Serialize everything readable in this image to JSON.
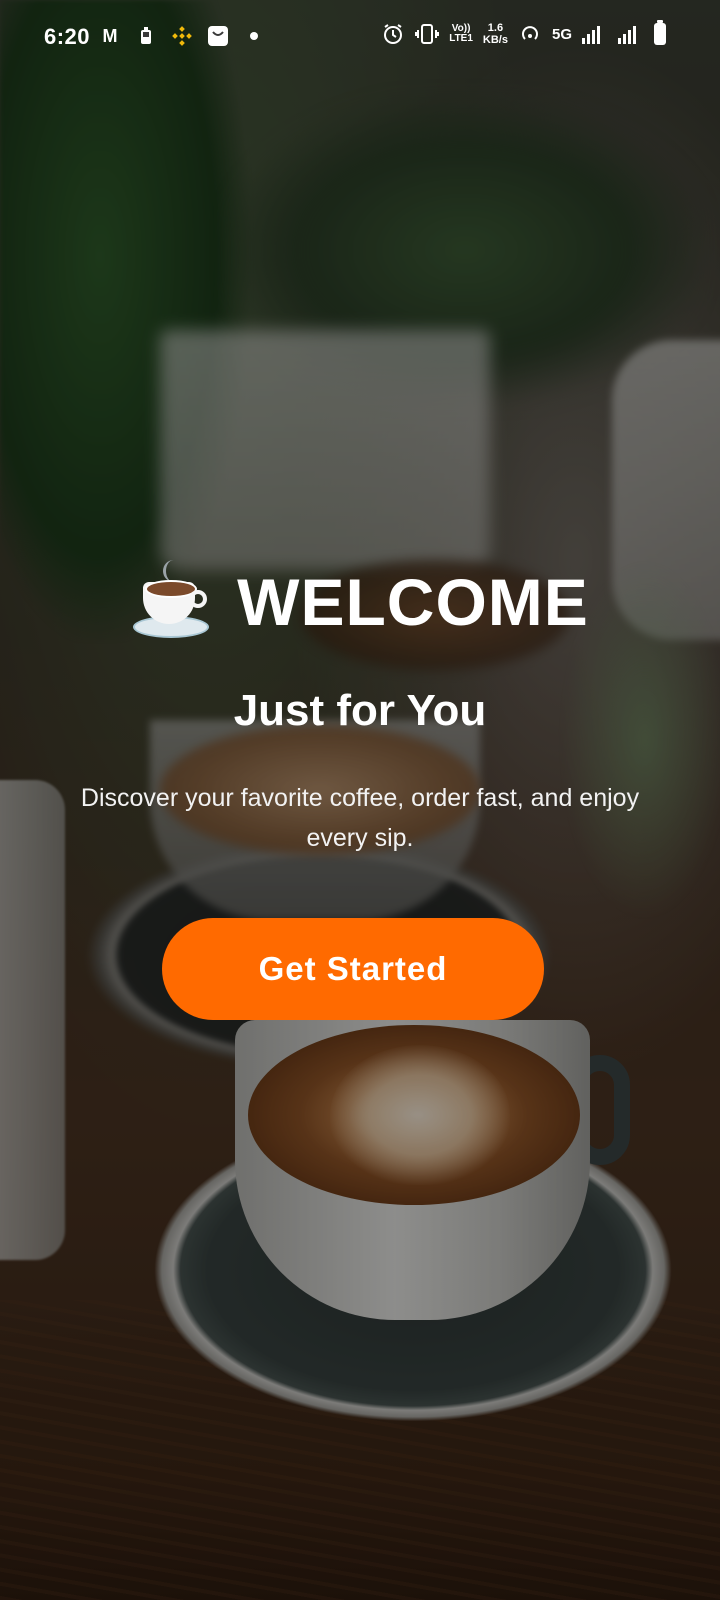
{
  "status_bar": {
    "time": "6:20",
    "left_icons": [
      "gmail-icon",
      "battery-saver-icon",
      "binance-icon",
      "shopping-bag-icon",
      "dot-icon"
    ],
    "right_icons": [
      "alarm-icon",
      "vibrate-icon",
      "volte-icon",
      "data-speed",
      "hotspot-icon",
      "5g-signal-icon",
      "signal-icon",
      "battery-icon"
    ],
    "volte_top": "Vo))",
    "volte_bottom": "LTE1",
    "speed_value": "1.6",
    "speed_unit": "KB/s",
    "network": "5G"
  },
  "welcome": {
    "icon": "coffee-cup-icon",
    "title": "WELCOME",
    "subtitle": "Just for You",
    "description": "Discover your favorite coffee, order fast, and enjoy every sip."
  },
  "cta": {
    "label": "Get Started",
    "color": "#ff6a00"
  }
}
